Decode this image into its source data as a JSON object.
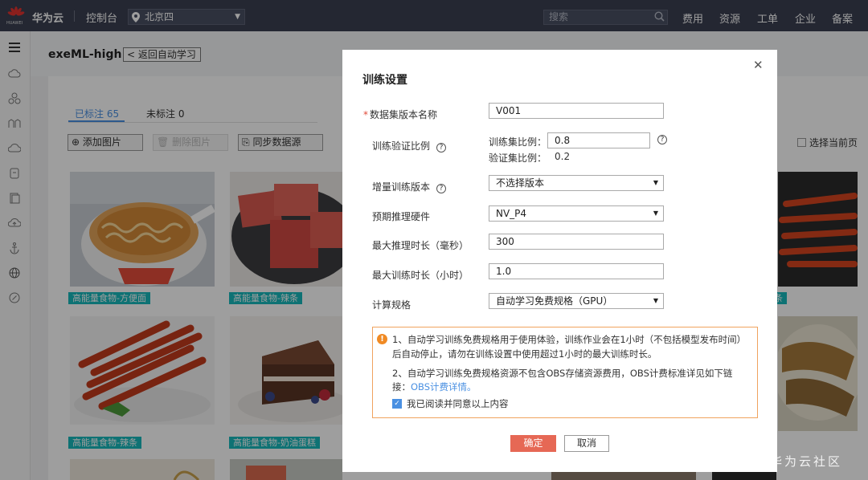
{
  "topbar": {
    "brand": "华为云",
    "logo_caption": "HUAWEI",
    "console": "控制台",
    "region": "北京四",
    "search_placeholder": "搜索",
    "nav": [
      "费用",
      "资源",
      "工单",
      "企业",
      "备案"
    ]
  },
  "sidebar": {
    "icons": [
      "menu-icon",
      "cloud-icon",
      "cluster-icon",
      "function-icon",
      "cloud-storage-icon",
      "bucket-icon",
      "file-icon",
      "cloud-upload-icon",
      "anchor-icon",
      "globe-icon",
      "settings-icon"
    ]
  },
  "page": {
    "title": "exeML-high",
    "back_label": "返回自动学习"
  },
  "tabs": [
    {
      "label": "已标注 65",
      "active": true
    },
    {
      "label": "未标注 0",
      "active": false
    }
  ],
  "toolbar": {
    "add_image": "添加图片",
    "delete_image": "删除图片",
    "sync_source": "同步数据源",
    "select_page": "选择当前页"
  },
  "gallery": {
    "labels": [
      "高能量食物-方便面",
      "高能量食物-辣条",
      "高能量食物-辣条",
      "高能量食物-奶油蛋糕",
      "条"
    ]
  },
  "dialog": {
    "title": "训练设置",
    "fields": {
      "dataset_version_label": "数据集版本名称",
      "dataset_version_value": "V001",
      "split_label": "训练验证比例",
      "train_ratio_label": "训练集比例：",
      "train_ratio_value": "0.8",
      "val_ratio_label": "验证集比例：",
      "val_ratio_value": "0.2",
      "incremental_label": "增量训练版本",
      "incremental_value": "不选择版本",
      "hardware_label": "预期推理硬件",
      "hardware_value": "NV_P4",
      "max_infer_label": "最大推理时长（毫秒）",
      "max_infer_value": "300",
      "max_train_label": "最大训练时长（小时）",
      "max_train_value": "1.0",
      "compute_label": "计算规格",
      "compute_value": "自动学习免费规格（GPU）"
    },
    "notice": {
      "line1": "1、自动学习训练免费规格用于使用体验，训练作业会在1小时（不包括模型发布时间）",
      "line1b": "后自动停止，请勿在训练设置中使用超过1小时的最大训练时长。",
      "line2": "2、自动学习训练免费规格资源不包含OBS存储资源费用，OBS计费标准详见如下链",
      "line2b_prefix": "接：",
      "link": "OBS计费详情。",
      "agree": "我已阅读并同意以上内容",
      "agree_checked": true
    },
    "ok": "确定",
    "cancel": "取消"
  },
  "watermark": "华为云社区",
  "colors": {
    "topbar": "#3a3f51",
    "accent": "#4a90e2",
    "label_tag": "#18b8bb",
    "primary_button": "#e66855",
    "notice_border": "#f0a35e"
  }
}
